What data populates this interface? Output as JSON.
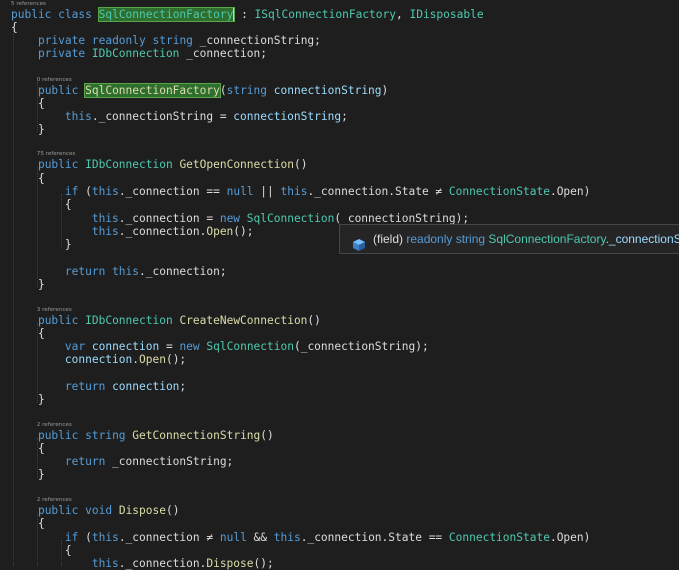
{
  "code_lines": [
    [
      {
        "t": "public",
        "k": "k"
      },
      {
        "t": " ",
        "k": "p"
      },
      {
        "t": "class",
        "k": "k"
      },
      {
        "t": " ",
        "k": "p"
      },
      {
        "t": "SqlConnectionFactory",
        "k": "hl"
      },
      {
        "t": " : ",
        "k": "p"
      },
      {
        "t": "ISqlConnectionFactory",
        "k": "t"
      },
      {
        "t": ", ",
        "k": "p"
      },
      {
        "t": "IDisposable",
        "k": "t"
      }
    ],
    [
      {
        "t": "{",
        "k": "p"
      }
    ],
    [
      {
        "t": "    ",
        "k": "p"
      },
      {
        "t": "private",
        "k": "k"
      },
      {
        "t": " ",
        "k": "p"
      },
      {
        "t": "readonly",
        "k": "k"
      },
      {
        "t": " ",
        "k": "p"
      },
      {
        "t": "string",
        "k": "k"
      },
      {
        "t": " _connectionString;",
        "k": "p"
      }
    ],
    [
      {
        "t": "    ",
        "k": "p"
      },
      {
        "t": "private",
        "k": "k"
      },
      {
        "t": " ",
        "k": "p"
      },
      {
        "t": "IDbConnection",
        "k": "t"
      },
      {
        "t": " _connection;",
        "k": "p"
      }
    ],
    [],
    [
      {
        "t": "    ",
        "k": "p"
      },
      {
        "t": "public",
        "k": "k"
      },
      {
        "t": " ",
        "k": "p"
      },
      {
        "t": "SqlConnectionFactory",
        "k": "hlm"
      },
      {
        "t": "(",
        "k": "p"
      },
      {
        "t": "string",
        "k": "k"
      },
      {
        "t": " ",
        "k": "p"
      },
      {
        "t": "connectionString",
        "k": "v"
      },
      {
        "t": ")",
        "k": "p"
      }
    ],
    [
      {
        "t": "    {",
        "k": "p"
      }
    ],
    [
      {
        "t": "        ",
        "k": "p"
      },
      {
        "t": "this",
        "k": "k"
      },
      {
        "t": "._connectionString = ",
        "k": "p"
      },
      {
        "t": "connectionString",
        "k": "v"
      },
      {
        "t": ";",
        "k": "p"
      }
    ],
    [
      {
        "t": "    }",
        "k": "p"
      }
    ],
    [],
    [
      {
        "t": "    ",
        "k": "p"
      },
      {
        "t": "public",
        "k": "k"
      },
      {
        "t": " ",
        "k": "p"
      },
      {
        "t": "IDbConnection",
        "k": "t"
      },
      {
        "t": " ",
        "k": "p"
      },
      {
        "t": "GetOpenConnection",
        "k": "m"
      },
      {
        "t": "()",
        "k": "p"
      }
    ],
    [
      {
        "t": "    {",
        "k": "p"
      }
    ],
    [
      {
        "t": "        ",
        "k": "p"
      },
      {
        "t": "if",
        "k": "k"
      },
      {
        "t": " (",
        "k": "p"
      },
      {
        "t": "this",
        "k": "k"
      },
      {
        "t": "._connection == ",
        "k": "p"
      },
      {
        "t": "null",
        "k": "k"
      },
      {
        "t": " || ",
        "k": "p"
      },
      {
        "t": "this",
        "k": "k"
      },
      {
        "t": "._connection.State ≠ ",
        "k": "p"
      },
      {
        "t": "ConnectionState",
        "k": "t"
      },
      {
        "t": ".Open)",
        "k": "p"
      }
    ],
    [
      {
        "t": "        {",
        "k": "p"
      }
    ],
    [
      {
        "t": "            ",
        "k": "p"
      },
      {
        "t": "this",
        "k": "k"
      },
      {
        "t": "._connection = ",
        "k": "p"
      },
      {
        "t": "new",
        "k": "k"
      },
      {
        "t": " ",
        "k": "p"
      },
      {
        "t": "SqlConnection",
        "k": "t"
      },
      {
        "t": "(_connectionString);",
        "k": "p"
      }
    ],
    [
      {
        "t": "            ",
        "k": "p"
      },
      {
        "t": "this",
        "k": "k"
      },
      {
        "t": "._connection.",
        "k": "p"
      },
      {
        "t": "Open",
        "k": "m"
      },
      {
        "t": "();",
        "k": "p"
      }
    ],
    [
      {
        "t": "        }",
        "k": "p"
      }
    ],
    [],
    [
      {
        "t": "        ",
        "k": "p"
      },
      {
        "t": "return",
        "k": "k"
      },
      {
        "t": " ",
        "k": "p"
      },
      {
        "t": "this",
        "k": "k"
      },
      {
        "t": "._connection;",
        "k": "p"
      }
    ],
    [
      {
        "t": "    }",
        "k": "p"
      }
    ],
    [],
    [
      {
        "t": "    ",
        "k": "p"
      },
      {
        "t": "public",
        "k": "k"
      },
      {
        "t": " ",
        "k": "p"
      },
      {
        "t": "IDbConnection",
        "k": "t"
      },
      {
        "t": " ",
        "k": "p"
      },
      {
        "t": "CreateNewConnection",
        "k": "m"
      },
      {
        "t": "()",
        "k": "p"
      }
    ],
    [
      {
        "t": "    {",
        "k": "p"
      }
    ],
    [
      {
        "t": "        ",
        "k": "p"
      },
      {
        "t": "var",
        "k": "k"
      },
      {
        "t": " ",
        "k": "p"
      },
      {
        "t": "connection",
        "k": "v"
      },
      {
        "t": " = ",
        "k": "p"
      },
      {
        "t": "new",
        "k": "k"
      },
      {
        "t": " ",
        "k": "p"
      },
      {
        "t": "SqlConnection",
        "k": "t"
      },
      {
        "t": "(_connectionString);",
        "k": "p"
      }
    ],
    [
      {
        "t": "        ",
        "k": "p"
      },
      {
        "t": "connection",
        "k": "v"
      },
      {
        "t": ".",
        "k": "p"
      },
      {
        "t": "Open",
        "k": "m"
      },
      {
        "t": "();",
        "k": "p"
      }
    ],
    [],
    [
      {
        "t": "        ",
        "k": "p"
      },
      {
        "t": "return",
        "k": "k"
      },
      {
        "t": " ",
        "k": "p"
      },
      {
        "t": "connection",
        "k": "v"
      },
      {
        "t": ";",
        "k": "p"
      }
    ],
    [
      {
        "t": "    }",
        "k": "p"
      }
    ],
    [],
    [
      {
        "t": "    ",
        "k": "p"
      },
      {
        "t": "public",
        "k": "k"
      },
      {
        "t": " ",
        "k": "p"
      },
      {
        "t": "string",
        "k": "k"
      },
      {
        "t": " ",
        "k": "p"
      },
      {
        "t": "GetConnectionString",
        "k": "m"
      },
      {
        "t": "()",
        "k": "p"
      }
    ],
    [
      {
        "t": "    {",
        "k": "p"
      }
    ],
    [
      {
        "t": "        ",
        "k": "p"
      },
      {
        "t": "return",
        "k": "k"
      },
      {
        "t": " _connectionString;",
        "k": "p"
      }
    ],
    [
      {
        "t": "    }",
        "k": "p"
      }
    ],
    [],
    [
      {
        "t": "    ",
        "k": "p"
      },
      {
        "t": "public",
        "k": "k"
      },
      {
        "t": " ",
        "k": "p"
      },
      {
        "t": "void",
        "k": "k"
      },
      {
        "t": " ",
        "k": "p"
      },
      {
        "t": "Dispose",
        "k": "m"
      },
      {
        "t": "()",
        "k": "p"
      }
    ],
    [
      {
        "t": "    {",
        "k": "p"
      }
    ],
    [
      {
        "t": "        ",
        "k": "p"
      },
      {
        "t": "if",
        "k": "k"
      },
      {
        "t": " (",
        "k": "p"
      },
      {
        "t": "this",
        "k": "k"
      },
      {
        "t": "._connection ≠ ",
        "k": "p"
      },
      {
        "t": "null",
        "k": "k"
      },
      {
        "t": " && ",
        "k": "p"
      },
      {
        "t": "this",
        "k": "k"
      },
      {
        "t": "._connection.State == ",
        "k": "p"
      },
      {
        "t": "ConnectionState",
        "k": "t"
      },
      {
        "t": ".Open)",
        "k": "p"
      }
    ],
    [
      {
        "t": "        {",
        "k": "p"
      }
    ],
    [
      {
        "t": "            ",
        "k": "p"
      },
      {
        "t": "this",
        "k": "k"
      },
      {
        "t": "._connection.",
        "k": "p"
      },
      {
        "t": "Dispose",
        "k": "m"
      },
      {
        "t": "();",
        "k": "p"
      }
    ]
  ],
  "code_lenses": [
    {
      "line": 0,
      "text": "5 references"
    },
    {
      "line": 5,
      "text": "0 references"
    },
    {
      "line": 10,
      "text": "75 references"
    },
    {
      "line": 21,
      "text": "3 references"
    },
    {
      "line": 29,
      "text": "2 references"
    },
    {
      "line": 34,
      "text": "2 references"
    }
  ],
  "tooltip": {
    "icon": "field-icon",
    "prefix": "(field) ",
    "keyword": "readonly",
    "type": "string",
    "class_name": "SqlConnectionFactory",
    "member": "._connectionS"
  },
  "colors": {
    "background": "#1e1e1e",
    "keyword": "#569cd6",
    "type": "#4ec9b0",
    "method": "#dcdcaa",
    "parameter": "#9cdcfe",
    "plain": "#dcdcdc",
    "highlight": "#2e6e2e"
  }
}
